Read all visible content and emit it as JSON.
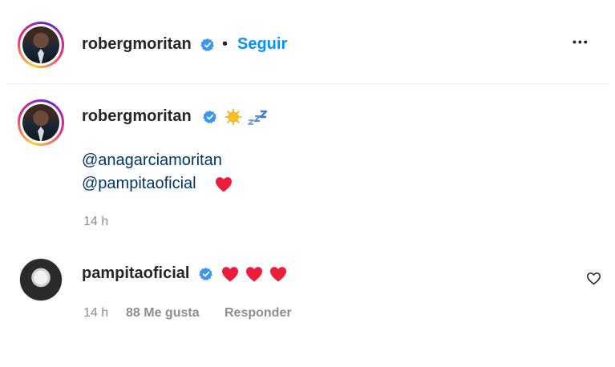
{
  "post_header": {
    "username": "robergmoritan",
    "separator": "•",
    "follow_label": "Seguir",
    "more_label": "•••"
  },
  "caption": {
    "username": "robergmoritan",
    "mentions": [
      "@anagarciamoritan",
      "@pampitaoficial"
    ],
    "timestamp": "14 h"
  },
  "comment": {
    "username": "pampitaoficial",
    "timestamp": "14 h",
    "likes": "88 Me gusta",
    "reply_label": "Responder"
  },
  "colors": {
    "link_blue": "#0095f6",
    "mention_blue": "#00376b",
    "verified_blue": "#3897f0",
    "heart_red": "#ed4956",
    "meta_gray": "#8e8e8e"
  }
}
